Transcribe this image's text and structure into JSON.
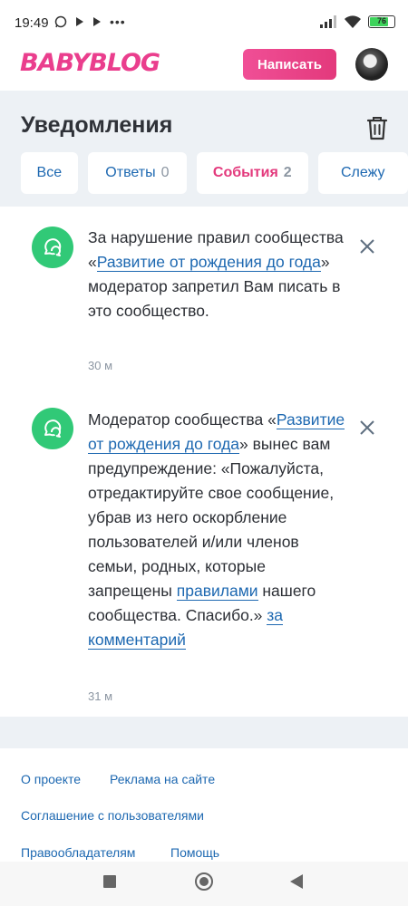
{
  "status_bar": {
    "time": "19:49",
    "battery": "76",
    "icons": [
      "whatsapp-icon",
      "play-icon",
      "play-icon",
      "more-icon",
      "signal-icon",
      "wifi-icon",
      "battery-icon"
    ]
  },
  "header": {
    "logo": "BABYBLOG",
    "write_button": "Написать",
    "brand_color": "#e3397c"
  },
  "page": {
    "title": "Уведомления"
  },
  "tabs": [
    {
      "label": "Все",
      "count": "",
      "active": false
    },
    {
      "label": "Ответы",
      "count": "0",
      "active": false
    },
    {
      "label": "События",
      "count": "2",
      "active": true
    },
    {
      "label": "Слежу",
      "count": "",
      "active": false
    }
  ],
  "notifications": [
    {
      "text_1": "За нарушение правил сообщества «",
      "link_1": "Развитие от рождения до года",
      "text_2": "» модератор запретил Вам писать в это сообщество.",
      "time": "30 м"
    },
    {
      "text_1": "Модератор сообщества «",
      "link_1": "Развитие от рождения до года",
      "text_2": "» вынес вам предупреждение: «Пожалуйста, отредактируйте свое сообщение, убрав из него оскорбление пользователей и/или членов семьи, родных, которые запрещены ",
      "link_2": "правилами",
      "text_3": " нашего сообщества. Спасибо.» ",
      "link_3": "за комментарий",
      "time": "31 м"
    }
  ],
  "footer": {
    "about": "О проекте",
    "ads": "Реклама на сайте",
    "agreement": "Соглашение с пользователями",
    "rights": "Правообладателям",
    "help": "Помощь"
  }
}
